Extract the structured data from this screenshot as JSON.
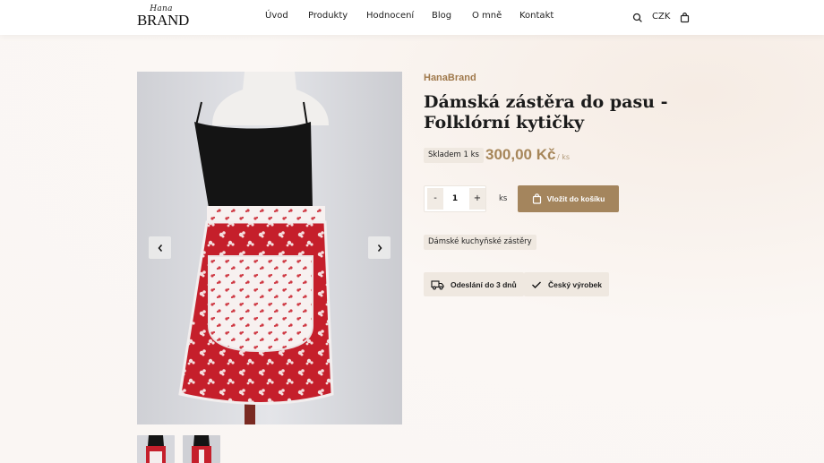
{
  "header": {
    "logo_script": "Hana",
    "logo_main": "BRAND",
    "nav": [
      "Úvod",
      "Produkty",
      "Hodnocení",
      "Blog",
      "O mně",
      "Kontakt"
    ],
    "currency": "CZK",
    "icons": [
      "search-icon",
      "shopping-bag-icon"
    ]
  },
  "gallery": {
    "prev_icon": "chevron-left-icon",
    "next_icon": "chevron-right-icon",
    "thumbnails": 2
  },
  "product": {
    "brand": "HanaBrand",
    "title": "Dámská zástěra do pasu - Folklórní kytičky",
    "stock": "Skladem 1 ks",
    "price": "300,00 Kč",
    "per_unit": "/ ks",
    "quantity": {
      "minus": "-",
      "value": "1",
      "plus": "+",
      "unit": "ks"
    },
    "add_to_cart": "Vložit do košíku",
    "category_tag": "Dámské kuchyňské zástěry",
    "features": [
      {
        "label": "Odeslání do 3 dnů",
        "icon": "truck-icon"
      },
      {
        "label": "Český výrobek",
        "icon": "check-icon"
      }
    ]
  },
  "colors": {
    "accent": "#a4855d",
    "brand_text": "#a0794c",
    "badge_bg": "#efe8e0"
  }
}
